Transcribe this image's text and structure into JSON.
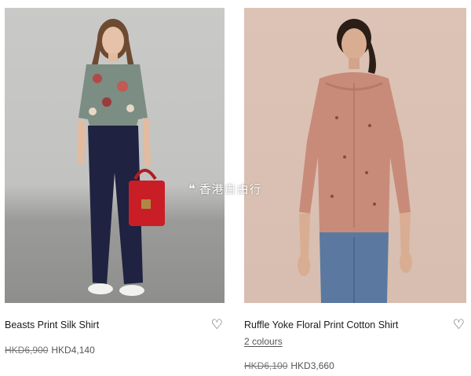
{
  "products": [
    {
      "name": "Beasts Print Silk Shirt",
      "old_price": "HKD6,900",
      "new_price": "HKD4,140"
    },
    {
      "name": "Ruffle Yoke Floral Print Cotton Shirt",
      "colours_link": "2 colours",
      "old_price": "HKD6,100",
      "new_price": "HKD3,660"
    }
  ],
  "watermark": {
    "text": "香港自由行",
    "icon": "wechat-icon"
  },
  "icons": {
    "wishlist": "heart-outline-icon"
  },
  "colors": {
    "bag": "#c91e26",
    "trousers": "#1f2240",
    "blouse": "#c98b79"
  }
}
